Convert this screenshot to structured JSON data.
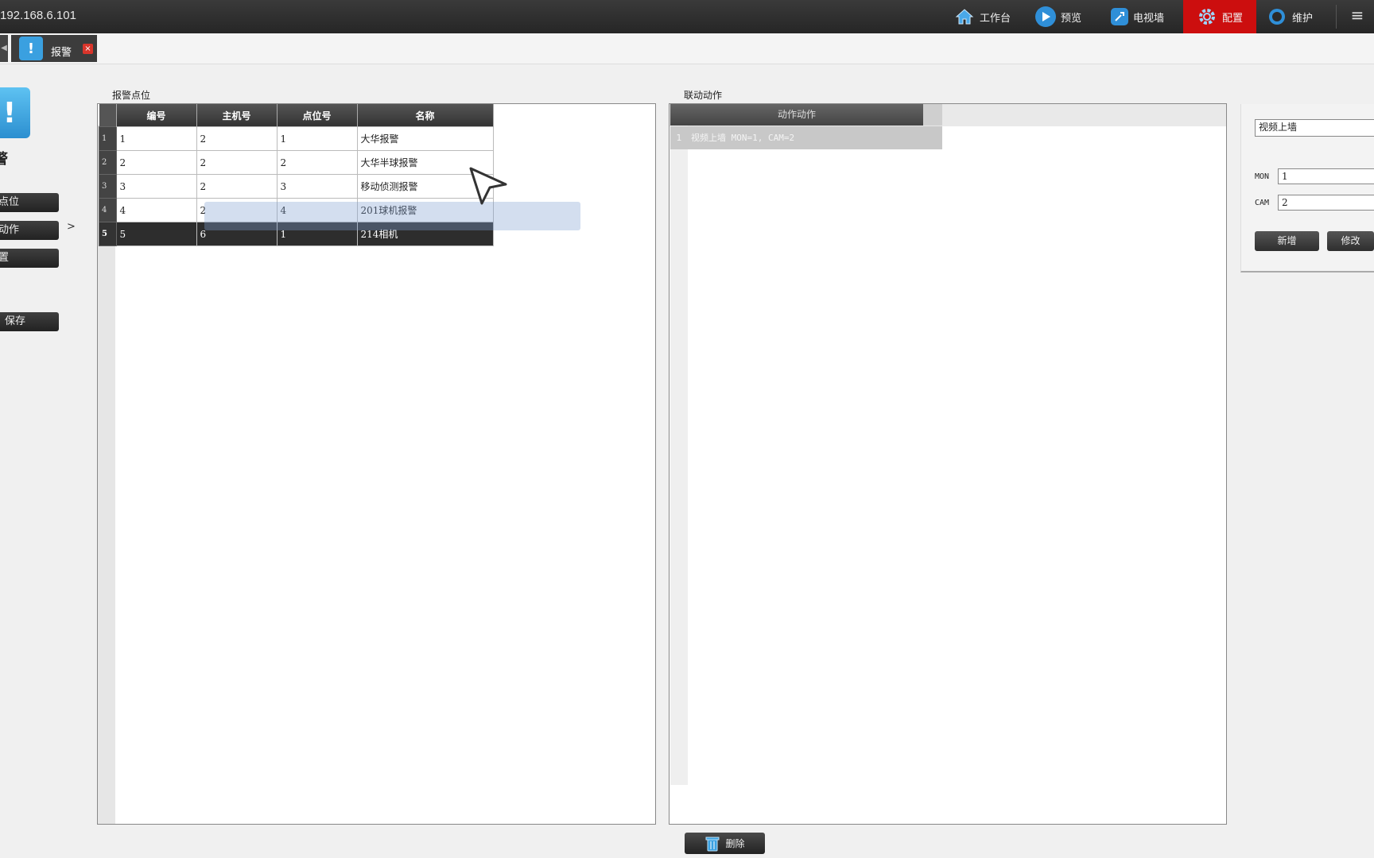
{
  "topbar": {
    "address": "192.168.6.101",
    "nav": [
      {
        "label": "工作台",
        "icon": "home-icon"
      },
      {
        "label": "预览",
        "icon": "play-icon"
      },
      {
        "label": "电视墙",
        "icon": "wrench-icon"
      },
      {
        "label": "配置",
        "icon": "gear-icon",
        "active": true
      },
      {
        "label": "维护",
        "icon": "ring-icon"
      }
    ],
    "menu_icon": "≡"
  },
  "tab": {
    "label": "报警",
    "close": "×"
  },
  "sidebar": {
    "title": "警",
    "buttons": [
      "点位",
      "动作",
      "置"
    ],
    "arrow": ">",
    "save": "保存"
  },
  "left": {
    "section_label": "报警点位",
    "columns": [
      "编号",
      "主机号",
      "点位号",
      "名称"
    ],
    "rows": [
      {
        "rn": "1",
        "cells": [
          "1",
          "2",
          "1",
          "大华报警"
        ]
      },
      {
        "rn": "2",
        "cells": [
          "2",
          "2",
          "2",
          "大华半球报警"
        ]
      },
      {
        "rn": "3",
        "cells": [
          "3",
          "2",
          "3",
          "移动侦测报警"
        ]
      },
      {
        "rn": "4",
        "cells": [
          "4",
          "2",
          "4",
          "201球机报警"
        ]
      },
      {
        "rn": "5",
        "cells": [
          "5",
          "6",
          "1",
          "214相机"
        ],
        "selected": true
      }
    ]
  },
  "right": {
    "section_label": "联动动作",
    "column": "动作动作",
    "row": {
      "rn": "1",
      "text": "视频上墙  MON=1, CAM=2"
    }
  },
  "form": {
    "action_value": "视频上墙",
    "mon_label": "MON",
    "mon_value": "1",
    "cam_label": "CAM",
    "cam_value": "2",
    "add_label": "新增",
    "modify_label": "修改"
  },
  "delete_label": "删除",
  "colors": {
    "active_nav": "#cc0e0e",
    "accent": "#3aa0e0"
  }
}
